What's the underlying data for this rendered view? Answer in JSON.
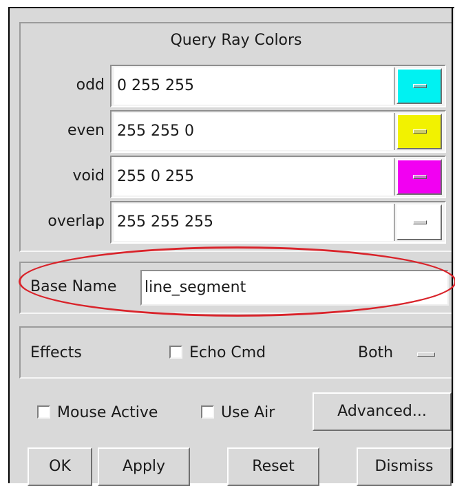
{
  "query_ray_colors": {
    "title": "Query Ray Colors",
    "rows": [
      {
        "label": "odd",
        "value": "0 255 255",
        "color": "#00f2f2"
      },
      {
        "label": "even",
        "value": "255 255 0",
        "color": "#f2f200"
      },
      {
        "label": "void",
        "value": "255 0 255",
        "color": "#f200f2"
      },
      {
        "label": "overlap",
        "value": "255 255 255",
        "color": "#ffffff"
      }
    ]
  },
  "base_name": {
    "label": "Base Name",
    "value": "line_segment",
    "highlight_color": "#d9232a"
  },
  "effects": {
    "label": "Effects",
    "echo_cmd_label": "Echo Cmd",
    "echo_cmd_checked": false,
    "mode_value": "Both"
  },
  "options": {
    "mouse_active_label": "Mouse Active",
    "mouse_active_checked": false,
    "use_air_label": "Use Air",
    "use_air_checked": false,
    "advanced_label": "Advanced..."
  },
  "buttons": {
    "ok": "OK",
    "apply": "Apply",
    "reset": "Reset",
    "dismiss": "Dismiss"
  }
}
